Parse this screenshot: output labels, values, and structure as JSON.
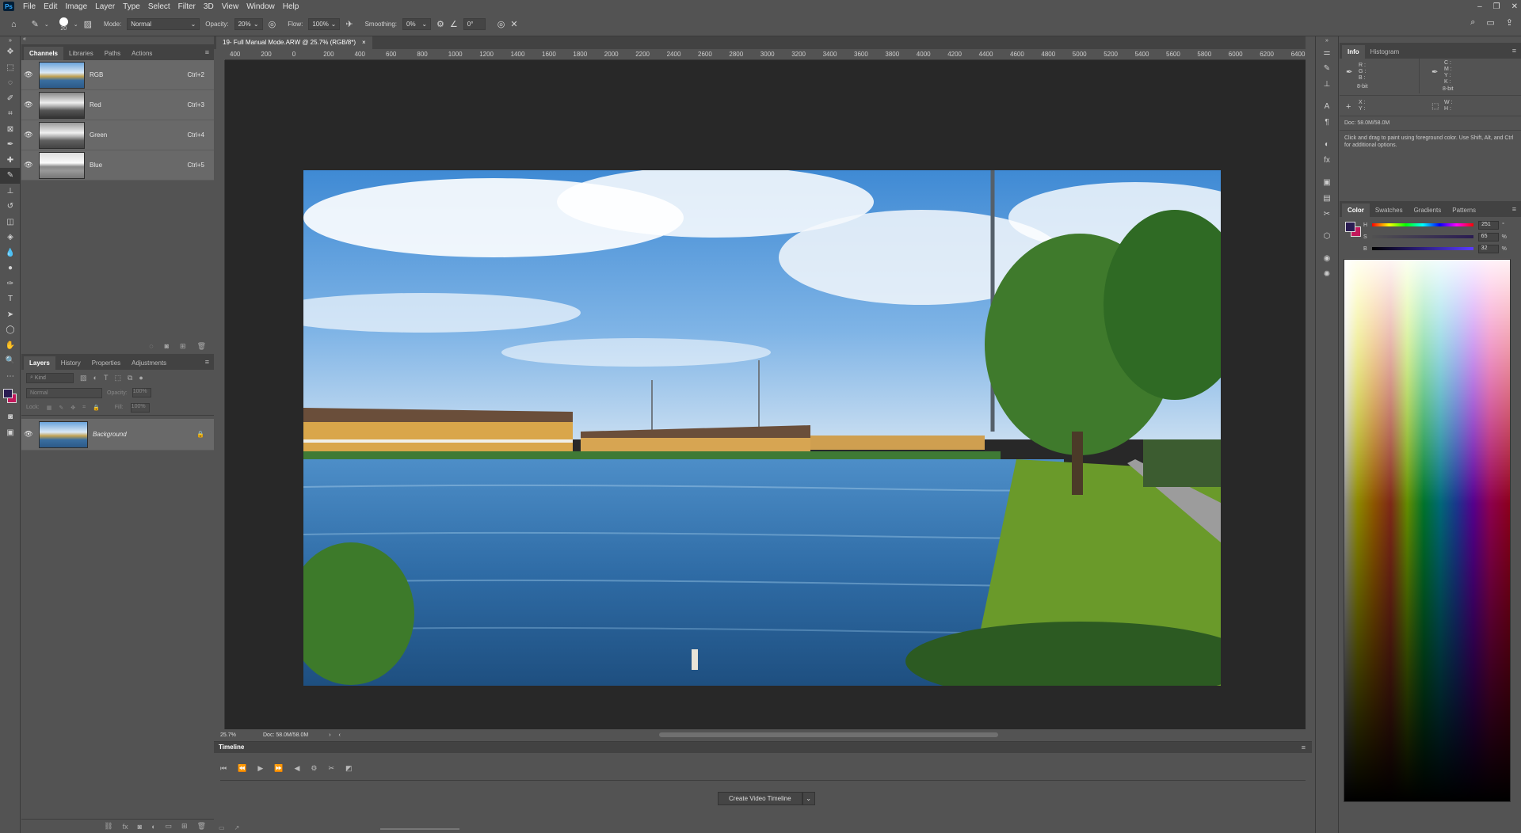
{
  "app": {
    "logo": "Ps"
  },
  "menu": [
    "File",
    "Edit",
    "Image",
    "Layer",
    "Type",
    "Select",
    "Filter",
    "3D",
    "View",
    "Window",
    "Help"
  ],
  "options": {
    "brush_size": "20",
    "mode_label": "Mode:",
    "mode_value": "Normal",
    "opacity_label": "Opacity:",
    "opacity_value": "20%",
    "flow_label": "Flow:",
    "flow_value": "100%",
    "smoothing_label": "Smoothing:",
    "smoothing_value": "0%",
    "angle_value": "0°"
  },
  "channels_panel": {
    "tabs": [
      "Channels",
      "Libraries",
      "Paths",
      "Actions"
    ],
    "channels": [
      {
        "name": "RGB",
        "shortcut": "Ctrl+2"
      },
      {
        "name": "Red",
        "shortcut": "Ctrl+3"
      },
      {
        "name": "Green",
        "shortcut": "Ctrl+4"
      },
      {
        "name": "Blue",
        "shortcut": "Ctrl+5"
      }
    ]
  },
  "layers_panel": {
    "tabs": [
      "Layers",
      "History",
      "Properties",
      "Adjustments"
    ],
    "kind_placeholder": "Kind",
    "blend_mode": "Normal",
    "opacity_label": "Opacity:",
    "opacity_value": "100%",
    "lock_label": "Lock:",
    "fill_label": "Fill:",
    "fill_value": "100%",
    "layers": [
      {
        "name": "Background"
      }
    ]
  },
  "document": {
    "tab_title": "19- Full Manual Mode.ARW @ 25.7% (RGB/8*)",
    "ruler_marks": [
      "400",
      "200",
      "0",
      "200",
      "400",
      "600",
      "800",
      "1000",
      "1200",
      "1400",
      "1600",
      "1800",
      "2000",
      "2200",
      "2400",
      "2600",
      "2800",
      "3000",
      "3200",
      "3400",
      "3600",
      "3800",
      "4000",
      "4200",
      "4400",
      "4600",
      "4800",
      "5000",
      "5200",
      "5400",
      "5600",
      "5800",
      "6000",
      "6200",
      "6400"
    ],
    "zoom": "25.7%",
    "doc_size": "Doc: 58.0M/58.0M"
  },
  "timeline": {
    "title": "Timeline",
    "create_button": "Create Video Timeline"
  },
  "info_panel": {
    "tabs": [
      "Info",
      "Histogram"
    ],
    "rgb_labels": [
      "R :",
      "G :",
      "B :"
    ],
    "cmyk_labels": [
      "C :",
      "M :",
      "Y :",
      "K :"
    ],
    "bit_left": "8-bit",
    "bit_right": "8-bit",
    "xy_labels": [
      "X :",
      "Y :"
    ],
    "wh_labels": [
      "W :",
      "H :"
    ],
    "doc_size": "Doc: 58.0M/58.0M",
    "hint": "Click and drag to paint using foreground color.  Use Shift, Alt, and Ctrl for additional options."
  },
  "color_panel": {
    "tabs": [
      "Color",
      "Swatches",
      "Gradients",
      "Patterns"
    ],
    "h_label": "H",
    "h_value": "251",
    "h_unit": "°",
    "s_label": "S",
    "s_value": "65",
    "s_unit": "%",
    "b_label": "B",
    "b_value": "32",
    "b_unit": "%",
    "foreground": "#2a1c52",
    "background": "#c2185b"
  }
}
